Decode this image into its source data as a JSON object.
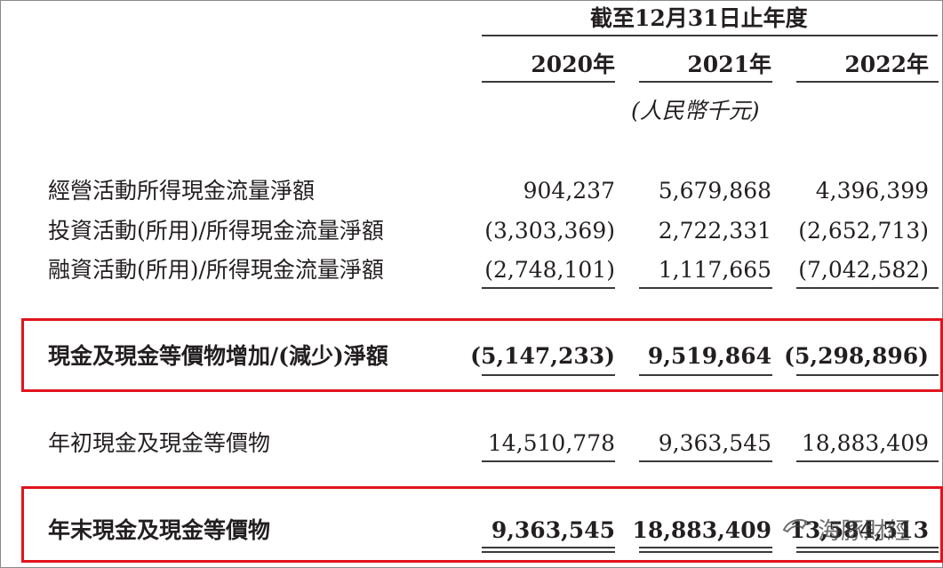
{
  "header": {
    "period": "截至12月31日止年度",
    "years": [
      "2020年",
      "2021年",
      "2022年"
    ],
    "unit": "(人民幣千元)"
  },
  "rows": [
    {
      "label": "經營活動所得現金流量淨額",
      "values": [
        "904,237",
        "5,679,868",
        "4,396,399"
      ]
    },
    {
      "label": "投資活動(所用)/所得現金流量淨額",
      "values": [
        "(3,303,369)",
        "2,722,331",
        "(2,652,713)"
      ]
    },
    {
      "label": "融資活動(所用)/所得現金流量淨額",
      "values": [
        "(2,748,101)",
        "1,117,665",
        "(7,042,582)"
      ]
    }
  ],
  "highlight_net": {
    "label": "現金及現金等價物增加/(減少)淨額",
    "values": [
      "(5,147,233)",
      "9,519,864",
      "(5,298,896)"
    ]
  },
  "opening": {
    "label": "年初現金及現金等價物",
    "values": [
      "14,510,778",
      "9,363,545",
      "18,883,409"
    ]
  },
  "highlight_closing": {
    "label": "年末現金及現金等價物",
    "values": [
      "9,363,545",
      "18,883,409",
      "13,584,513"
    ]
  },
  "watermark": {
    "text": "海豚財經",
    "icon": "dolphin-icon"
  },
  "colors": {
    "highlight_border": "#e0141e",
    "text": "#231f20"
  }
}
